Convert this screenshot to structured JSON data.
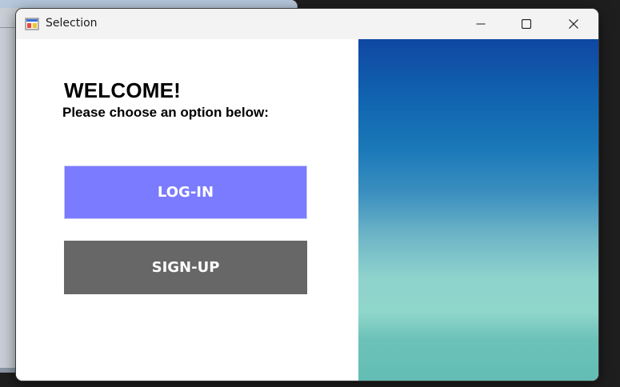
{
  "window": {
    "title": "Selection",
    "controls": {
      "minimize_icon": "minimize-icon",
      "maximize_icon": "maximize-icon",
      "close_icon": "close-icon"
    }
  },
  "main": {
    "heading": "WELCOME!",
    "subheading": "Please choose an option below:",
    "login_label": "LOG-IN",
    "signup_label": "SIGN-UP"
  },
  "colors": {
    "login_button": "#7b7bff",
    "signup_button": "#676767",
    "gradient_top": "#0f47a3",
    "gradient_bottom": "#63bdb4",
    "window_background": "#ffffff",
    "desktop_background": "#1e1e1e"
  }
}
